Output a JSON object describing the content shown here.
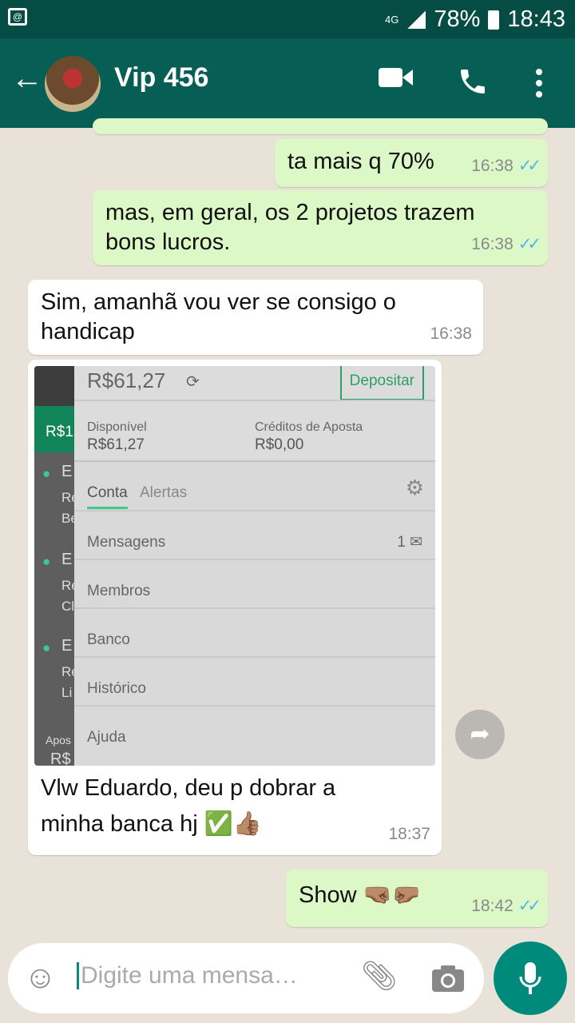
{
  "status_bar": {
    "network": "4G",
    "battery": "78%",
    "time": "18:43"
  },
  "header": {
    "contact_name": "Vip 456"
  },
  "messages": [
    {
      "dir": "out",
      "text": "ta mais q 70%",
      "time": "16:38"
    },
    {
      "dir": "out",
      "text": "mas, em geral, os 2 projetos trazem bons lucros.",
      "time": "16:38"
    },
    {
      "dir": "in",
      "text": "Sim, amanhã vou ver se consigo o handicap",
      "time": "16:38"
    },
    {
      "dir": "in",
      "caption": "Vlw Eduardo, deu p dobrar a minha banca hj ✅👍🏽",
      "time": "18:37"
    },
    {
      "dir": "out",
      "text": "Show 🤜🏽🤛🏽",
      "time": "18:42"
    }
  ],
  "screenshot": {
    "balance": "R$61,27",
    "deposit": "Depositar",
    "available_label": "Disponível",
    "available_value": "R$61,27",
    "credits_label": "Créditos de Aposta",
    "credits_value": "R$0,00",
    "tabs": [
      "Conta",
      "Alertas"
    ],
    "menu": [
      "Mensagens",
      "Membros",
      "Banco",
      "Histórico",
      "Ajuda"
    ],
    "messages_count": "1",
    "side_fragments": [
      "R$1",
      "E",
      "Re",
      "Be",
      "E",
      "Re",
      "Cl",
      "E",
      "Re",
      "Li",
      "Apos",
      "R$"
    ]
  },
  "input": {
    "placeholder": "Digite uma mensa…"
  },
  "colors": {
    "header": "#075e54",
    "outgoing": "#dcf8c6",
    "accent": "#008a7c",
    "read_ticks": "#4fb6ec"
  }
}
